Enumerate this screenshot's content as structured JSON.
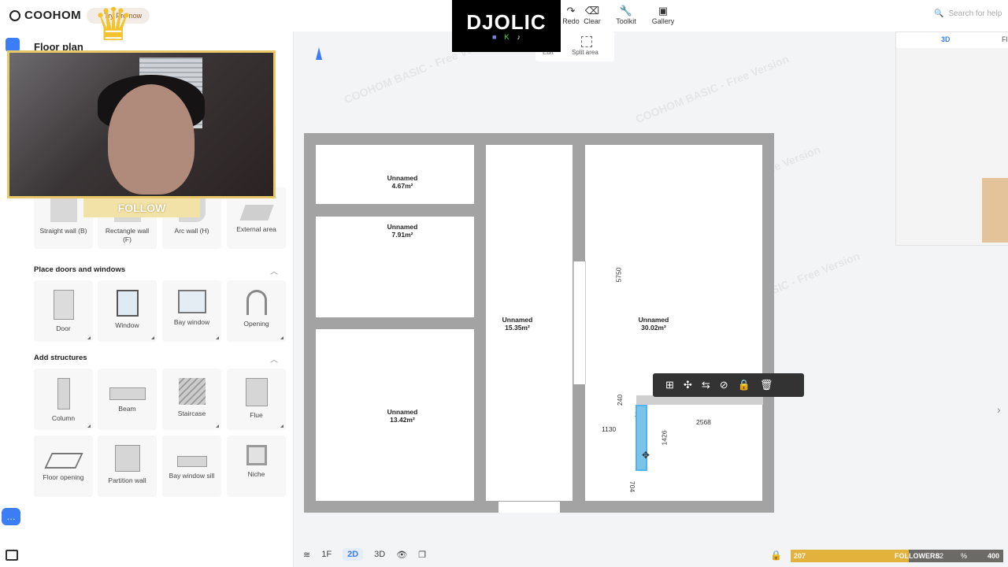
{
  "app": {
    "brand": "COOHOM",
    "try_pro": "Try Pro now"
  },
  "toolbar": {
    "redo": "Redo",
    "clear": "Clear",
    "toolkit": "Toolkit",
    "gallery": "Gallery",
    "edit": "Edit",
    "split_area": "Split area",
    "search_placeholder": "Search for help"
  },
  "panel": {
    "title": "Floor plan",
    "walls": [
      {
        "label": "Straight wall (B)"
      },
      {
        "label": "Rectangle wall (F)"
      },
      {
        "label": "Arc wall (H)"
      },
      {
        "label": "External area"
      }
    ],
    "doors_section": "Place doors and windows",
    "doors": [
      {
        "label": "Door"
      },
      {
        "label": "Window"
      },
      {
        "label": "Bay window"
      },
      {
        "label": "Opening"
      }
    ],
    "structures_section": "Add structures",
    "structures": [
      {
        "label": "Column"
      },
      {
        "label": "Beam"
      },
      {
        "label": "Staircase"
      },
      {
        "label": "Flue"
      },
      {
        "label": "Floor opening"
      },
      {
        "label": "Partition wall"
      },
      {
        "label": "Bay window sill"
      },
      {
        "label": "Niche"
      }
    ]
  },
  "overlay": {
    "follow": "FOLLOW",
    "streamer": "DJOLIC"
  },
  "rooms": [
    {
      "name": "Unnamed",
      "area": "4.67m²"
    },
    {
      "name": "Unnamed",
      "area": "7.91m²"
    },
    {
      "name": "Unnamed",
      "area": "13.42m²"
    },
    {
      "name": "Unnamed",
      "area": "15.35m²"
    },
    {
      "name": "Unnamed",
      "area": "30.02m²"
    }
  ],
  "dimensions": {
    "d5750": "5750",
    "d240a": "240",
    "d240b": "240",
    "d1130": "1130",
    "d1426": "1426",
    "d2568": "2568",
    "d704": "704"
  },
  "watermark": "COOHOM BASIC - Free Version",
  "preview": {
    "tab3d": "3D",
    "tab_fl": "Fl"
  },
  "bottom": {
    "floor": "1F",
    "mode2d": "2D",
    "mode3d": "3D"
  },
  "followers": {
    "count": "207",
    "label": "FOLLOWERS",
    "pct": "82",
    "pct_sign": "%",
    "goal": "400"
  }
}
